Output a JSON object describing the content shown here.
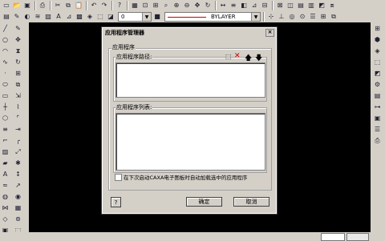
{
  "toolbar": {
    "layer_value": "0",
    "linetype_label": "BYLAYER",
    "line_color": "#cc0000"
  },
  "dialog": {
    "title": "应用程序管理器",
    "group_label": "应用程序",
    "path_label": "应用程序路径:",
    "list_label": "应用程序列表:",
    "checkbox_label": "在下次启动CAXA电子图板时自动加载选中的应用程序",
    "help_label": "?",
    "ok_label": "确定",
    "cancel_label": "取消",
    "close_glyph": "×"
  },
  "colors": {
    "canvas": "#000000",
    "chrome": "#d4d0c8"
  }
}
